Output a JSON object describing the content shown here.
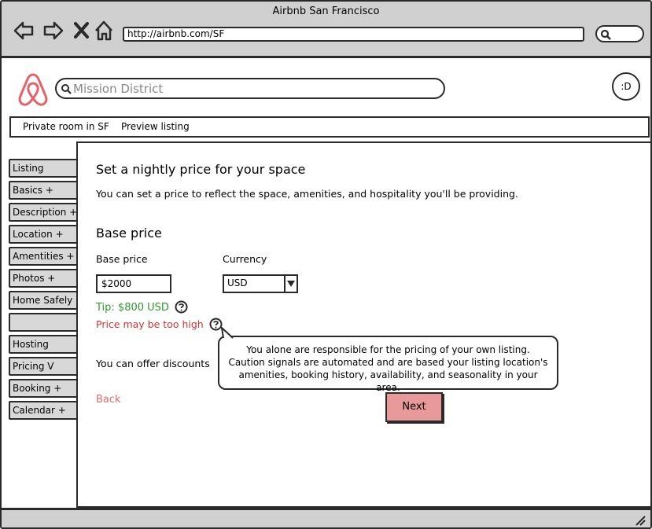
{
  "window": {
    "title": "Airbnb San Francisco"
  },
  "browser": {
    "url": "http://airbnb.com/SF",
    "nav_icons": [
      "back-arrow-icon",
      "forward-arrow-icon",
      "close-icon",
      "home-icon"
    ]
  },
  "header": {
    "search_value": "Mission District",
    "avatar_text": ":D",
    "brand_color": "#e8606a"
  },
  "breadcrumb": [
    "Private room in SF",
    "Preview listing"
  ],
  "sidebar": {
    "items": [
      "Listing",
      "Basics +",
      "Description +",
      "Location +",
      "Amentities +",
      "Photos +",
      "Home Safely",
      "",
      "Hosting",
      "Pricing V",
      "Booking +",
      "Calendar +"
    ]
  },
  "main": {
    "heading": "Set a nightly price for your space",
    "intro": "You can set a price to reflect the space, amenities, and hospitality you'll be providing.",
    "section_title": "Base price",
    "base_price_label": "Base price",
    "base_price_value": "$2000",
    "currency_label": "Currency",
    "currency_value": "USD",
    "tip_text": "Tip: $800 USD",
    "warning_text": "Price may be too high",
    "discounts_text": "You can offer discounts",
    "tooltip_text": "You alone are responsible for the pricing of your own listing. Caution signals are automated and are based your listing location's amenities, booking history, availability, and seasonality in your area.",
    "back_label": "Back",
    "next_label": "Next",
    "colors": {
      "tip": "#2e9a2e",
      "warning": "#d13333",
      "back": "#e06c6c",
      "next_bg": "#e8999a"
    }
  }
}
